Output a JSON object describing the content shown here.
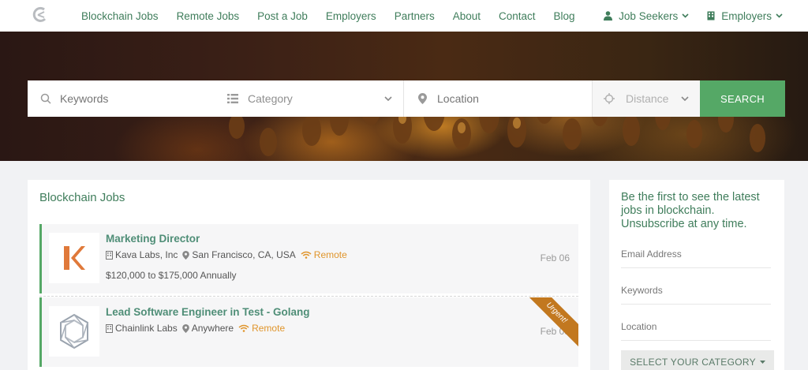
{
  "nav": {
    "links": [
      "Blockchain Jobs",
      "Remote Jobs",
      "Post a Job",
      "Employers",
      "Partners",
      "About",
      "Contact",
      "Blog"
    ],
    "job_seekers": "Job Seekers",
    "employers": "Employers"
  },
  "search": {
    "keywords_placeholder": "Keywords",
    "category_placeholder": "Category",
    "location_placeholder": "Location",
    "distance_placeholder": "Distance",
    "button": "SEARCH"
  },
  "jobs": {
    "title": "Blockchain Jobs",
    "items": [
      {
        "title": "Marketing Director",
        "company": "Kava Labs, Inc",
        "location": "San Francisco, CA, USA",
        "remote": "Remote",
        "salary": "$120,000 to $175,000 Annually",
        "date": "Feb 06"
      },
      {
        "title": "Lead Software Engineer in Test - Golang",
        "company": "Chainlink Labs",
        "location": "Anywhere",
        "remote": "Remote",
        "date": "Feb 05",
        "badge": "Urgent!"
      }
    ]
  },
  "sidebar": {
    "title": "Be the first to see the latest jobs in blockchain. Unsubscribe at any time.",
    "email_placeholder": "Email Address",
    "keywords_placeholder": "Keywords",
    "location_placeholder": "Location",
    "category_button": "SELECT YOUR CATEGORY"
  },
  "colors": {
    "accent": "#55a866",
    "link": "#3f7d5b",
    "remote": "#e0952c",
    "ribbon": "#c2781f"
  }
}
